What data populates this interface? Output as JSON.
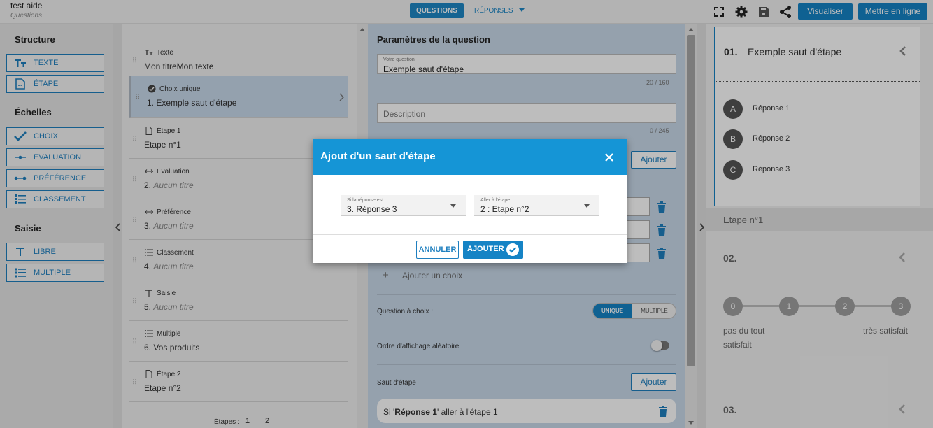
{
  "app": {
    "title": "test aide",
    "subtitle": "Questions"
  },
  "header": {
    "tabs": [
      {
        "label": "QUESTIONS"
      },
      {
        "label": "RÉPONSES"
      }
    ],
    "visualiser_label": "Visualiser",
    "publish_label": "Mettre en ligne"
  },
  "sidebar": {
    "sections": [
      {
        "title": "Structure"
      },
      {
        "title": "Échelles"
      },
      {
        "title": "Saisie"
      }
    ],
    "buttons": {
      "texte": "TEXTE",
      "etape": "ÉTAPE",
      "choix": "CHOIX",
      "evaluation": "EVALUATION",
      "preference": "PRÉFÉRENCE",
      "classement": "CLASSEMENT",
      "libre": "LIBRE",
      "multiple": "MULTIPLE"
    }
  },
  "questions": [
    {
      "type": "Texte",
      "name": "Mon titreMon texte",
      "placeholder": ""
    },
    {
      "type": "Choix unique",
      "name": "1. Exemple saut d'étape",
      "placeholder": ""
    },
    {
      "type": "Étape 1",
      "name": "Etape n°1",
      "placeholder": ""
    },
    {
      "type": "Evaluation",
      "name": "2. ",
      "placeholder": "Aucun titre"
    },
    {
      "type": "Préférence",
      "name": "3. ",
      "placeholder": "Aucun titre"
    },
    {
      "type": "Classement",
      "name": "4. ",
      "placeholder": "Aucun titre"
    },
    {
      "type": "Saisie",
      "name": "5. ",
      "placeholder": "Aucun titre"
    },
    {
      "type": "Multiple",
      "name": "6. Vos produits",
      "placeholder": ""
    },
    {
      "type": "Étape 2",
      "name": "Etape n°2",
      "placeholder": ""
    }
  ],
  "steps_footer": {
    "label": "Étapes :",
    "pages": [
      "1",
      "2"
    ]
  },
  "params": {
    "title": "Paramètres de la question",
    "question_label": "Votre question",
    "question_value": "Exemple saut d'étape",
    "question_count": "20 / 160",
    "description_placeholder": "Description",
    "description_count": "0 / 245",
    "ajouter_label": "Ajouter",
    "add_choice_label": "Ajouter un choix",
    "choice_type_label": "Question à choix :",
    "choice_unique": "UNIQUE",
    "choice_multiple": "MULTIPLE",
    "random_order_label": "Ordre d'affichage aléatoire",
    "skip_label": "Saut d'étape",
    "skip_ajouter": "Ajouter",
    "skip_rule_prefix": "Si '",
    "skip_rule_answer": "Réponse 1",
    "skip_rule_suffix": "' aller à l'étape 1"
  },
  "preview": {
    "q1_number": "01.",
    "q1_title": "Exemple saut d'étape",
    "answers": [
      {
        "letter": "A",
        "label": "Réponse 1"
      },
      {
        "letter": "B",
        "label": "Réponse 2"
      },
      {
        "letter": "C",
        "label": "Réponse 3"
      }
    ],
    "step_label": "Etape n°1",
    "q2_number": "02.",
    "scale": [
      "0",
      "1",
      "2",
      "3"
    ],
    "scale_low": "pas du tout satisfait",
    "scale_high": "très satisfait",
    "q3_number": "03."
  },
  "modal": {
    "title": "Ajout d'un saut d'étape",
    "if_label": "Si la réponse est...",
    "if_value": "3. Réponse 3",
    "goto_label": "Aller à l'étape...",
    "goto_value": "2 : Etape n°2",
    "cancel_label": "ANNULER",
    "ok_label": "AJOUTER"
  },
  "colors": {
    "accent": "#1583c5",
    "modal_header": "#1595d6",
    "selected_row": "#c8d9eb"
  }
}
